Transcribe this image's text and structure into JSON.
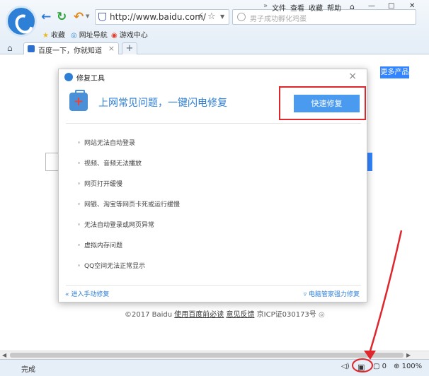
{
  "browser": {
    "url": "http://www.baidu.com/",
    "search_placeholder": "男子成功孵化鸡蛋",
    "menu": {
      "file": "文件",
      "view": "查看",
      "favorites": "收藏",
      "help": "帮助"
    },
    "window_controls": {
      "more": "»",
      "minimize": "—",
      "restore": "□",
      "close": "✕"
    },
    "bookmarks": {
      "favorites": "收藏",
      "nav": "网址导航",
      "games": "游戏中心"
    },
    "tab_title": "百度一下，你就知道",
    "tab_close": "×",
    "new_tab": "+"
  },
  "page": {
    "more_products": "更多产品",
    "footer": {
      "copyright": "©2017 Baidu",
      "must_read": "使用百度前必读",
      "feedback": "意见反馈",
      "icp": "京ICP证030173号"
    }
  },
  "dialog": {
    "title": "修复工具",
    "close": "×",
    "heading": "上网常见问题，一键闪电修复",
    "quick_fix": "快速修复",
    "items": [
      "网站无法自动登录",
      "视频、音频无法播放",
      "网页打开缓慢",
      "网银、淘宝等网页卡死或运行缓慢",
      "无法自动登录或网页异常",
      "虚拟内存问题",
      "QQ空间无法正常显示"
    ],
    "manual_repair": "进入手动修复",
    "pc_manager": "电脑管家强力修复"
  },
  "status": {
    "text": "完成",
    "count": "0",
    "zoom": "100%"
  },
  "colors": {
    "accent": "#2e7fd6",
    "baidu_blue": "#3385ff",
    "highlight": "#e0262d"
  }
}
